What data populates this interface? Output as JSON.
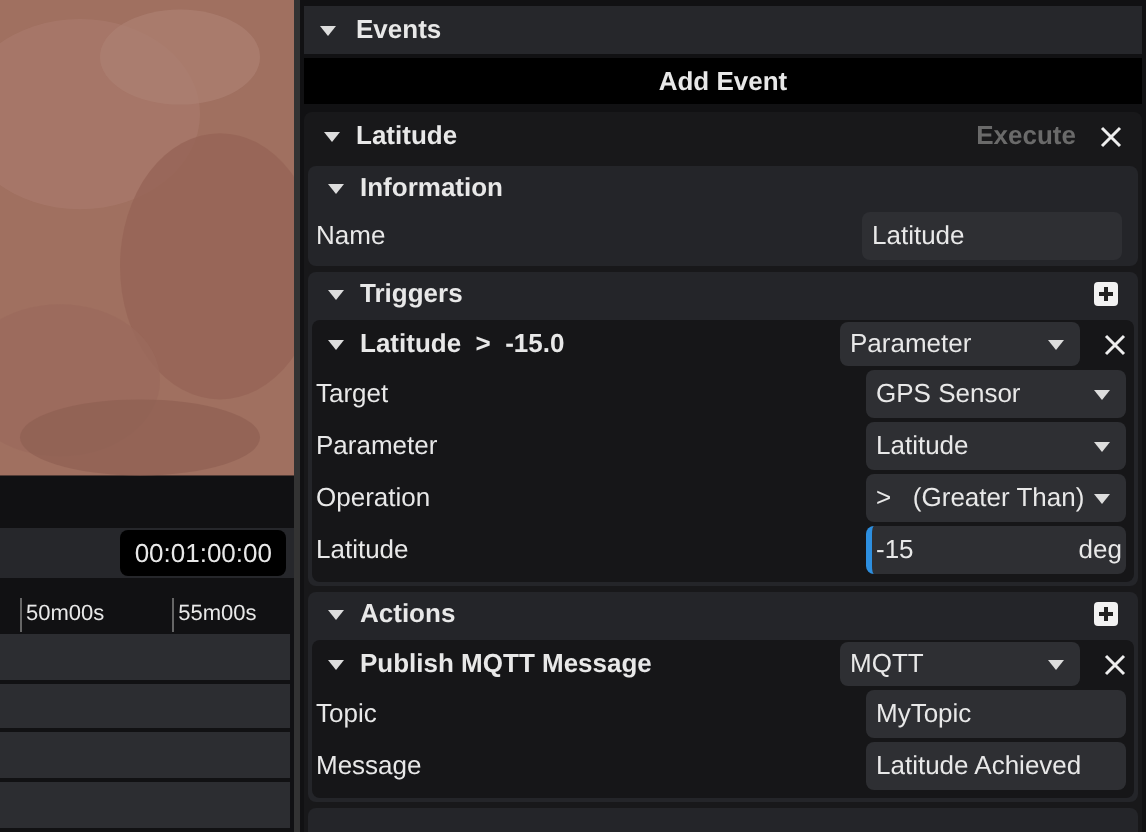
{
  "timeline": {
    "timecode": "00:01:00:00",
    "ticks": [
      "50m00s",
      "55m00s"
    ]
  },
  "events": {
    "title": "Events",
    "add_button": "Add Event",
    "event": {
      "name": "Latitude",
      "execute": {
        "label": "Execute",
        "disabled": true
      },
      "information": {
        "title": "Information",
        "fields": [
          {
            "kind": "text",
            "label": "Name",
            "value": "Latitude"
          }
        ]
      },
      "triggers": {
        "title": "Triggers",
        "items": [
          {
            "title": "Latitude  >  -15.0",
            "type": "Parameter",
            "fields": [
              {
                "kind": "select",
                "label": "Target",
                "value": "GPS Sensor"
              },
              {
                "kind": "select",
                "label": "Parameter",
                "value": "Latitude"
              },
              {
                "kind": "select",
                "label": "Operation",
                "value": ">   (Greater Than)"
              },
              {
                "kind": "number",
                "label": "Latitude",
                "value": "-15",
                "unit": "deg"
              }
            ]
          }
        ]
      },
      "actions": {
        "title": "Actions",
        "items": [
          {
            "title": "Publish MQTT Message",
            "type": "MQTT",
            "fields": [
              {
                "kind": "text",
                "label": "Topic",
                "value": "MyTopic"
              },
              {
                "kind": "text",
                "label": "Message",
                "value": "Latitude Achieved"
              }
            ]
          }
        ]
      }
    }
  }
}
